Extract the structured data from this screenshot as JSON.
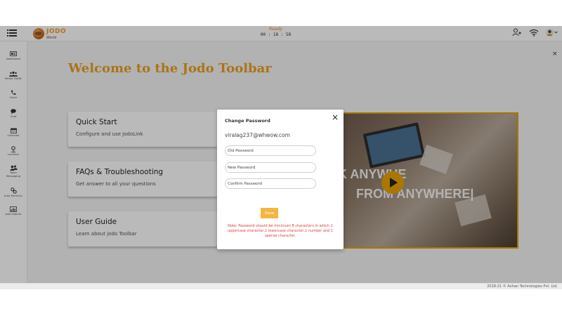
{
  "header": {
    "brand": "JODO",
    "brand_sub": "World",
    "status": "Ready",
    "timer": "00 : 18 : 58"
  },
  "sidebar": {
    "items": [
      {
        "label": "Dashboard",
        "icon": "dashboard-icon"
      },
      {
        "label": "Media Traffic",
        "icon": "people-icon"
      },
      {
        "label": "Voice",
        "icon": "phone-icon"
      },
      {
        "label": "Chat",
        "icon": "chat-icon"
      },
      {
        "label": "Calendar",
        "icon": "calendar-icon"
      },
      {
        "label": "Location",
        "icon": "location-icon"
      },
      {
        "label": "Team Messaging",
        "icon": "team-icon"
      },
      {
        "label": "Jodo Services",
        "icon": "services-icon"
      },
      {
        "label": "Jodo reports",
        "icon": "reports-icon"
      }
    ]
  },
  "main": {
    "welcome": "Welcome to the Jodo Toolbar",
    "cards": [
      {
        "title": "Quick Start",
        "desc": "Configure and use JodoLink"
      },
      {
        "title": "FAQs & Troubleshooting",
        "desc": "Get answer to all your questions"
      },
      {
        "title": "User Guide",
        "desc": "Learn about jodo Toolbar"
      }
    ],
    "video": {
      "line1": "K ANYWHE",
      "line2": "FROM ANYWHERE|"
    }
  },
  "modal": {
    "title": "Change Password",
    "email": "viralag237@whwow.com",
    "old_placeholder": "Old Password",
    "new_placeholder": "New Password",
    "confirm_placeholder": "Confirm Password",
    "save_label": "Save",
    "note": "Note: Password should be minimum 8 characters in which 1 uppercase character,1 lowercase character,1 number and 1 special character."
  },
  "footer": {
    "copyright": "2018-21 © Axhan Technologies Pvt. Ltd."
  },
  "colors": {
    "accent": "#eba020",
    "note": "#e04040",
    "save": "#f5b63f"
  }
}
